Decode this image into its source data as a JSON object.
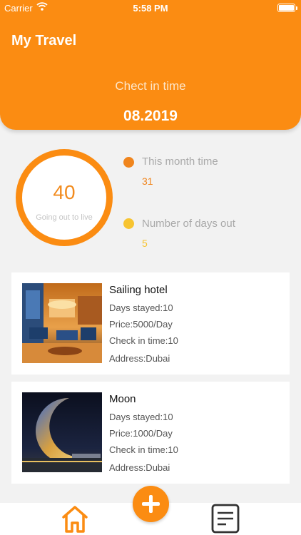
{
  "status_bar": {
    "carrier": "Carrier",
    "time": "5:58 PM",
    "wifi_icon": "wifi-icon",
    "battery_icon": "battery-icon"
  },
  "header": {
    "title": "My Travel",
    "checkin_label": "Chect in time",
    "checkin_date": "08.2019",
    "background_color": "#fb8c12"
  },
  "stats": {
    "ring_value": "40",
    "ring_caption": "Going out to live",
    "items": [
      {
        "label": "This month time",
        "value": "31",
        "dot_color": "#f0851d",
        "value_color": "#f0851d"
      },
      {
        "label": "Number of days out",
        "value": "5",
        "dot_color": "#f7c431",
        "value_color": "#f7c431"
      }
    ]
  },
  "hotels": [
    {
      "name": "Sailing hotel",
      "days": "Days stayed:10",
      "price": "Price:5000/Day",
      "checkin": "Check in time:10",
      "address": "Address:Dubai"
    },
    {
      "name": "Moon",
      "days": "Days stayed:10",
      "price": "Price:1000/Day",
      "checkin": "Check in time:10",
      "address": "Address:Dubai"
    }
  ],
  "tabbar": {
    "home_icon": "home-icon",
    "add_icon": "plus-icon",
    "list_icon": "document-list-icon",
    "accent_color": "#fb8c12"
  }
}
